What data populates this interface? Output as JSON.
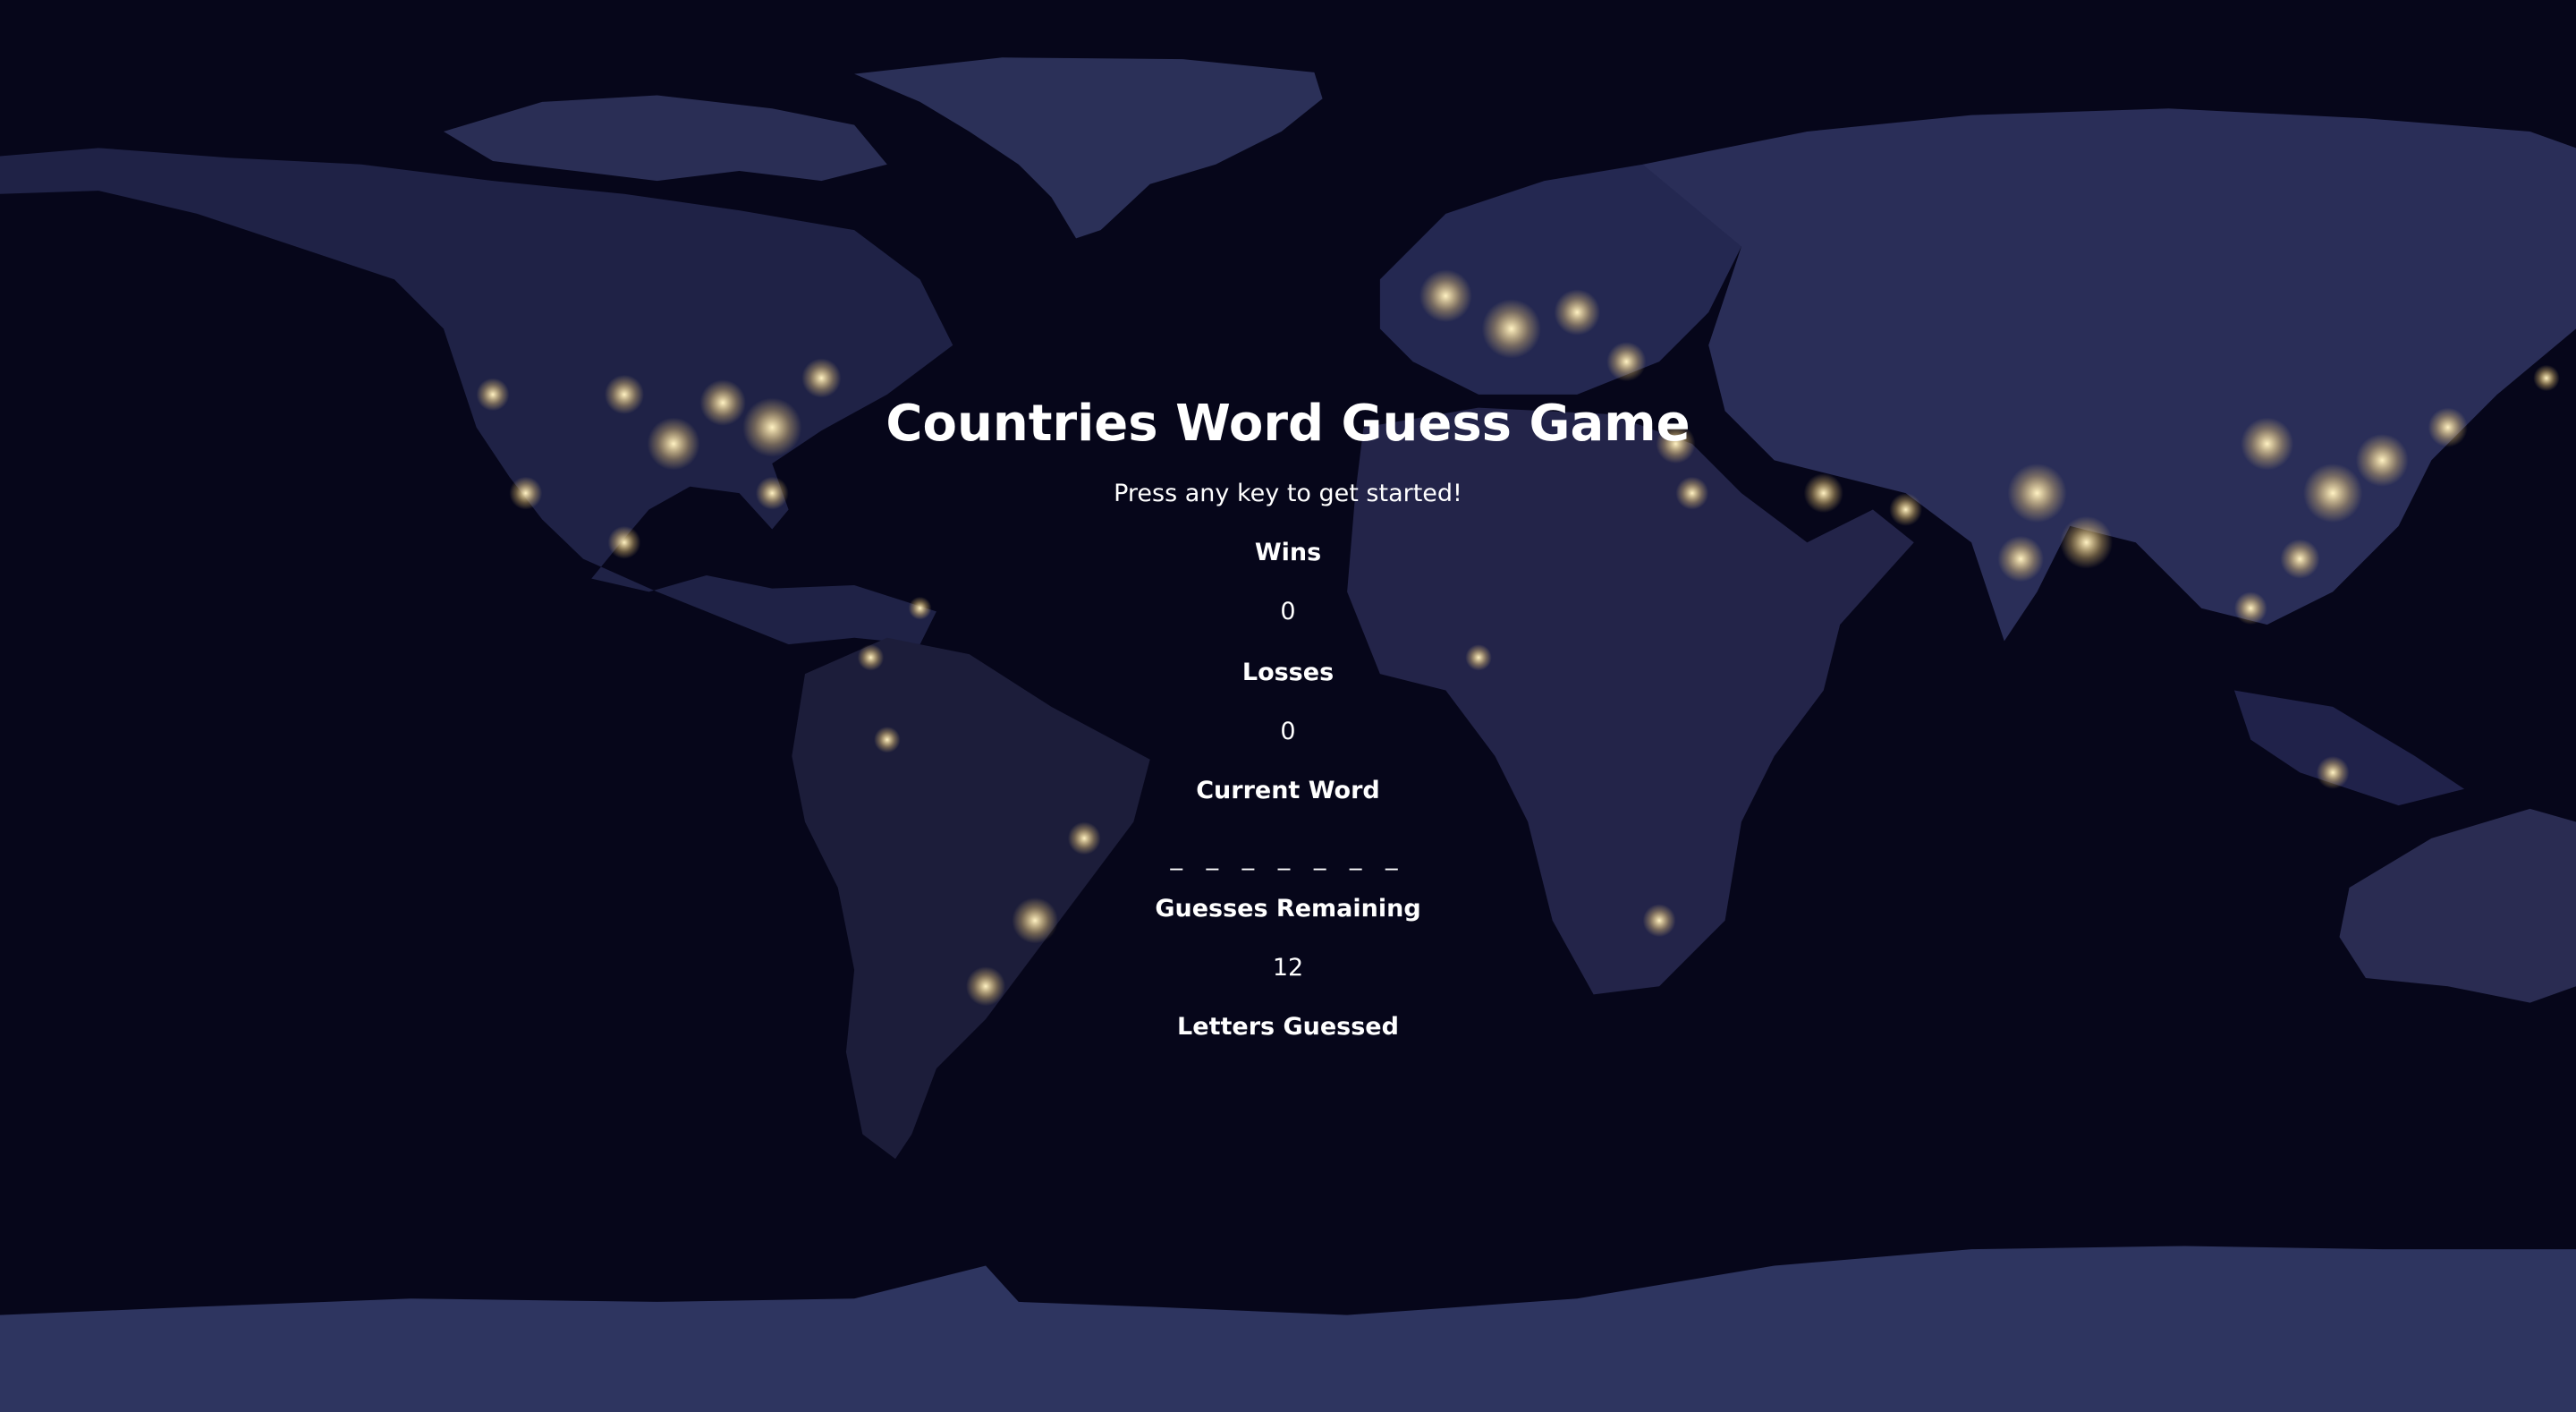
{
  "game": {
    "title": "Countries Word Guess Game",
    "instructions": "Press any key to get started!",
    "wins_label": "Wins",
    "wins": "0",
    "losses_label": "Losses",
    "losses": "0",
    "current_word_label": "Current Word",
    "current_word": "_ _ _ _ _ _ _",
    "guesses_remaining_label": "Guesses Remaining",
    "guesses_remaining": "12",
    "letters_guessed_label": "Letters Guessed",
    "letters_guessed": ""
  },
  "background": {
    "image": "world-map-at-night",
    "colors": {
      "ocean": "#06061a",
      "land": "#262a52",
      "ice": "#2e3560",
      "city_lights": "#ffe7a8"
    }
  }
}
